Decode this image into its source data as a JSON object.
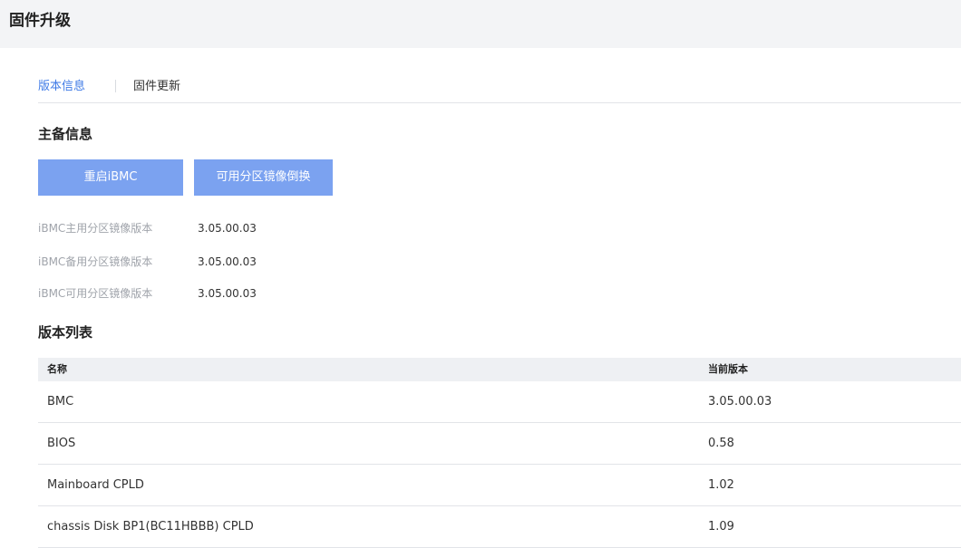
{
  "page": {
    "title": "固件升级"
  },
  "tabs": [
    {
      "label": "版本信息",
      "active": true
    },
    {
      "label": "固件更新",
      "active": false
    }
  ],
  "primary_backup": {
    "title": "主备信息",
    "buttons": {
      "restart_label": "重启iBMC",
      "switch_label": "可用分区镜像倒换"
    },
    "rows": [
      {
        "label": "iBMC主用分区镜像版本",
        "value": "3.05.00.03"
      },
      {
        "label": "iBMC备用分区镜像版本",
        "value": "3.05.00.03"
      },
      {
        "label": "iBMC可用分区镜像版本",
        "value": "3.05.00.03"
      }
    ]
  },
  "version_list": {
    "title": "版本列表",
    "columns": [
      "名称",
      "当前版本"
    ],
    "rows": [
      {
        "name": "BMC",
        "version": "3.05.00.03"
      },
      {
        "name": "BIOS",
        "version": "0.58"
      },
      {
        "name": "Mainboard CPLD",
        "version": "1.02"
      },
      {
        "name": "chassis Disk BP1(BC11HBBB) CPLD",
        "version": "1.09"
      }
    ]
  },
  "colors": {
    "accent": "#3e7ae6",
    "button": "#7ba2f0",
    "header_bg": "#f3f4f6",
    "table_head_bg": "#eef0f3"
  }
}
